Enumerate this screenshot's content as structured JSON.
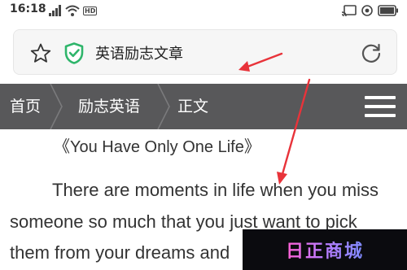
{
  "status_bar": {
    "time": "16:18",
    "icons_left": [
      "signal-icon",
      "wifi-icon",
      "hd-icon"
    ],
    "hd_label": "HD",
    "icons_right": [
      "cast-icon",
      "lock-icon",
      "battery-icon"
    ]
  },
  "address_bar": {
    "title": "英语励志文章",
    "icons": [
      "star-icon",
      "shield-check-icon",
      "refresh-icon"
    ],
    "shield_color": "#2fb56b"
  },
  "nav": {
    "items": [
      {
        "label": "首页"
      },
      {
        "label": "励志英语"
      },
      {
        "label": "正文"
      }
    ],
    "menu_icon": "menu-icon",
    "background": "#58585a"
  },
  "article": {
    "title": "《You Have Only One Life》",
    "lines": [
      "There are moments in life when you miss",
      "someone so much that you just want to pick",
      "them from your dreams and"
    ]
  },
  "annotations": {
    "arrow_color": "#e8333a",
    "count": 2
  },
  "watermark": {
    "text": "日正商城"
  }
}
